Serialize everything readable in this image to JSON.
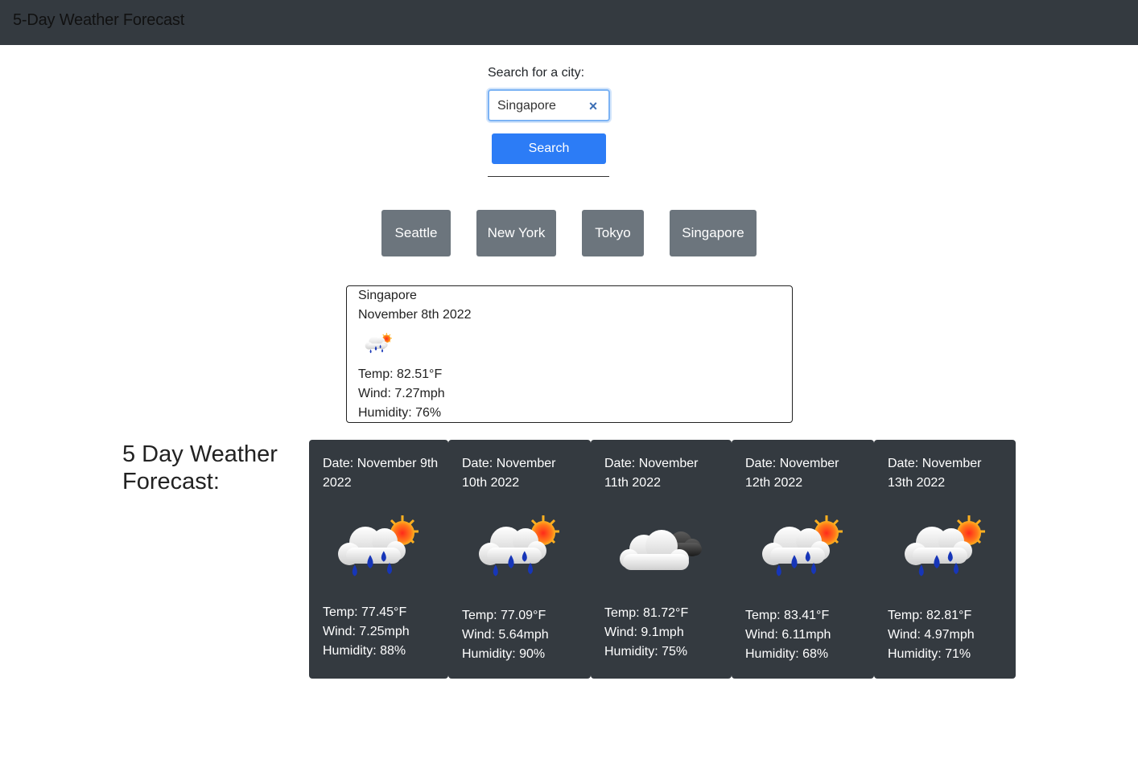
{
  "navbar": {
    "title": "5-Day Weather Forecast"
  },
  "search": {
    "label": "Search for a city:",
    "value": "Singapore",
    "clear_icon": "×",
    "button_label": "Search"
  },
  "history": [
    "Seattle",
    "New York",
    "Tokyo",
    "Singapore"
  ],
  "current": {
    "city": "Singapore",
    "date": "November 8th 2022",
    "icon": "rain-sun-icon",
    "temp": "Temp: 82.51°F",
    "wind": "Wind: 7.27mph",
    "humidity": "Humidity: 76%"
  },
  "forecast_heading": "5 Day Weather Forecast:",
  "forecast": [
    {
      "date": "Date: November 9th 2022",
      "icon": "rain-sun-icon",
      "temp": "Temp: 77.45°F",
      "wind": "Wind: 7.25mph",
      "humidity": "Humidity: 88%"
    },
    {
      "date": "Date: November 10th 2022",
      "icon": "rain-sun-icon",
      "temp": "Temp: 77.09°F",
      "wind": "Wind: 5.64mph",
      "humidity": "Humidity: 90%"
    },
    {
      "date": "Date: November 11th 2022",
      "icon": "cloud-moon-icon",
      "temp": "Temp: 81.72°F",
      "wind": "Wind: 9.1mph",
      "humidity": "Humidity: 75%"
    },
    {
      "date": "Date: November 12th 2022",
      "icon": "rain-sun-icon",
      "temp": "Temp: 83.41°F",
      "wind": "Wind: 6.11mph",
      "humidity": "Humidity: 68%"
    },
    {
      "date": "Date: November 13th 2022",
      "icon": "rain-sun-icon",
      "temp": "Temp: 82.81°F",
      "wind": "Wind: 4.97mph",
      "humidity": "Humidity: 71%"
    }
  ],
  "colors": {
    "navbar": "#343a40",
    "accent": "#2c7cf6",
    "history_button": "#6c757d",
    "card": "#343a40"
  }
}
